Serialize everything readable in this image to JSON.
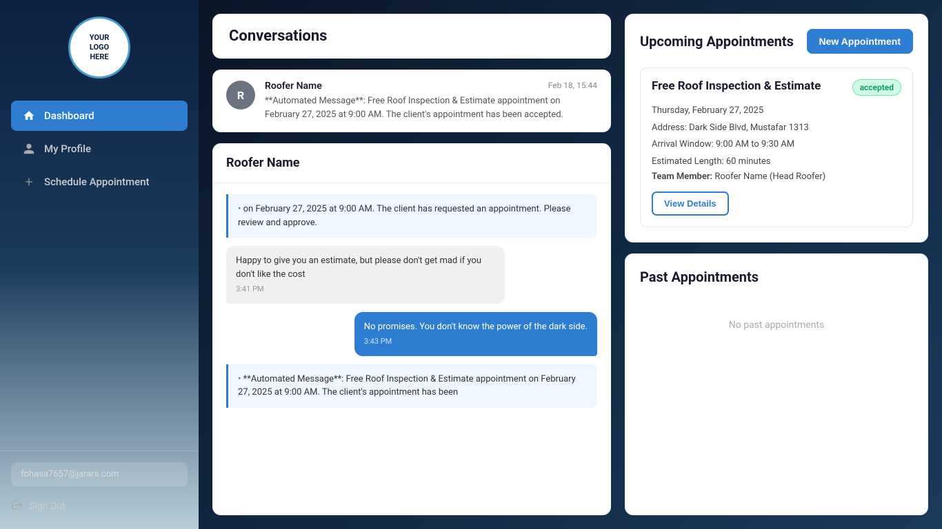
{
  "sidebar": {
    "logo_line1": "YOUR",
    "logo_line2": "LOGO",
    "logo_line3": "HERE",
    "nav_items": [
      {
        "id": "dashboard",
        "label": "Dashboard",
        "icon": "🏠",
        "active": true
      },
      {
        "id": "my-profile",
        "label": "My Profile",
        "icon": "👤",
        "active": false
      },
      {
        "id": "schedule-appointment",
        "label": "Schedule Appointment",
        "icon": "+",
        "active": false
      }
    ],
    "email": "fohasa7657@jarars.com",
    "sign_out": "Sign Out"
  },
  "conversations": {
    "title": "Conversations",
    "items": [
      {
        "avatar": "R",
        "name": "Roofer Name",
        "time": "Feb 18, 15:44",
        "preview": "**Automated Message**: Free Roof Inspection & Estimate appointment on February 27, 2025 at 9:00 AM. The client's appointment has been accepted."
      }
    ]
  },
  "chat": {
    "title": "Roofer Name",
    "messages": [
      {
        "type": "automated",
        "text": "on February 27, 2025 at 9:00 AM. The client has requested an appointment. Please review and approve."
      },
      {
        "type": "left",
        "text": "Happy to give you an estimate, but please don't get mad if you don't like the cost",
        "time": "3:41 PM"
      },
      {
        "type": "right",
        "text": "No promises. You don't know the power of the dark side.",
        "time": "3:43 PM"
      },
      {
        "type": "automated",
        "text": "**Automated Message**: Free Roof Inspection & Estimate appointment on February 27, 2025 at 9:00 AM. The client's appointment has been"
      }
    ]
  },
  "upcoming_appointments": {
    "title": "Upcoming Appointments",
    "new_button": "New Appointment",
    "items": [
      {
        "name": "Free Roof Inspection & Estimate",
        "status": "accepted",
        "date": "Thursday, February 27, 2025",
        "address": "Address: Dark Side Blvd, Mustafar 1313",
        "arrival": "Arrival Window: 9:00 AM to 9:30 AM",
        "length": "Estimated Length: 60 minutes",
        "team_label": "Team Member:",
        "team_value": "Roofer Name (Head Roofer)",
        "view_button": "View Details"
      }
    ]
  },
  "past_appointments": {
    "title": "Past Appointments",
    "empty_text": "No past appointments"
  }
}
